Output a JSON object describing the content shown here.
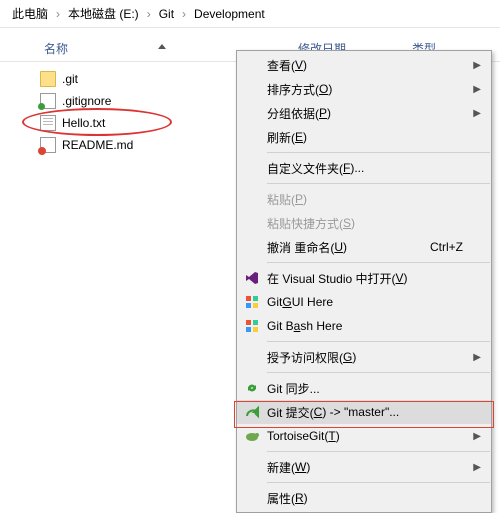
{
  "breadcrumb": {
    "pc": "此电脑",
    "drive": "本地磁盘 (E:)",
    "folder1": "Git",
    "folder2": "Development",
    "sep": "›"
  },
  "columns": {
    "name": "名称",
    "date": "修改日期",
    "type": "类型"
  },
  "files": [
    {
      "name": ".git",
      "icon": "folder"
    },
    {
      "name": ".gitignore",
      "icon": "gi"
    },
    {
      "name": "Hello.txt",
      "icon": "txt"
    },
    {
      "name": "README.md",
      "icon": "md"
    }
  ],
  "menu": {
    "view": {
      "label": "查看(",
      "key": "V",
      "tail": ")"
    },
    "sort": {
      "label": "排序方式(",
      "key": "O",
      "tail": ")"
    },
    "group": {
      "label": "分组依据(",
      "key": "P",
      "tail": ")"
    },
    "refresh": {
      "label": "刷新(",
      "key": "E",
      "tail": ")"
    },
    "custom": {
      "label": "自定义文件夹(",
      "key": "F",
      "tail": ")..."
    },
    "paste": {
      "label": "粘贴(",
      "key": "P",
      "tail": ")"
    },
    "pasteShortcut": {
      "label": "粘贴快捷方式(",
      "key": "S",
      "tail": ")"
    },
    "undo": {
      "label": "撤消 重命名(",
      "key": "U",
      "tail": ")",
      "shortcut": "Ctrl+Z"
    },
    "vs": {
      "label": "在 Visual Studio 中打开(",
      "key": "V",
      "tail": ")"
    },
    "gitgui": {
      "pre": "Git ",
      "key": "G",
      "post": "UI Here"
    },
    "gitbash": {
      "pre": "Git B",
      "key": "a",
      "post": "sh Here"
    },
    "access": {
      "label": "授予访问权限(",
      "key": "G",
      "tail": ")"
    },
    "gitsync": {
      "label": "Git 同步..."
    },
    "gitcommit": {
      "label": "Git 提交(",
      "key": "C",
      "tail": ") -> \"master\"..."
    },
    "tortoise": {
      "label": "TortoiseGit(",
      "key": "T",
      "tail": ")"
    },
    "new": {
      "label": "新建(",
      "key": "W",
      "tail": ")"
    },
    "props": {
      "label": "属性(",
      "key": "R",
      "tail": ")"
    }
  }
}
